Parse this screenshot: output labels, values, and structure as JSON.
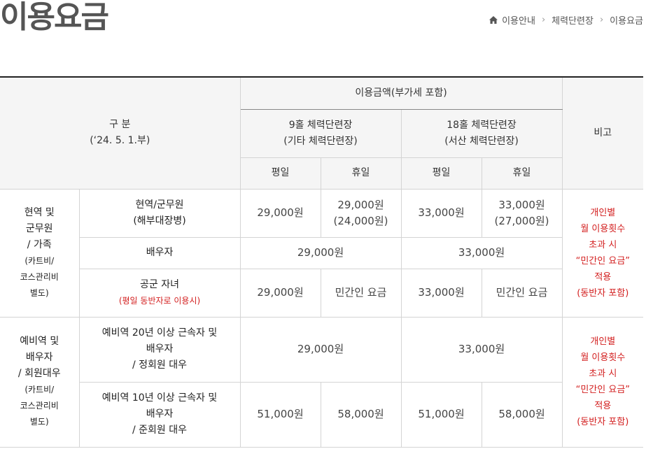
{
  "page": {
    "title": "이용요금"
  },
  "breadcrumb": {
    "items": [
      "이용안내",
      "체력단련장",
      "이용요금"
    ]
  },
  "table": {
    "header": {
      "category": "구 분",
      "category_date": "(‘24. 5. 1.부)",
      "fee_group": "이용금액(부가세 포함)",
      "course9": "9홀 체력단련장",
      "course9_sub": "(기타 체력단련장)",
      "course18": "18홀 체력단련장",
      "course18_sub": "(서산 체력단련장)",
      "weekday": "평일",
      "holiday": "휴일",
      "note": "비고"
    },
    "group1": {
      "category_lines": [
        "현역 및",
        "군무원",
        "/ 가족"
      ],
      "category_small": [
        "(카트비/",
        "코스관리비",
        "별도)"
      ],
      "rows": [
        {
          "sub": "현역/군무원",
          "sub2": "(해부대장병)",
          "w9": "29,000원",
          "h9": "29,000원",
          "h9_2": "(24,000원)",
          "w18": "33,000원",
          "h18": "33,000원",
          "h18_2": "(27,000원)"
        },
        {
          "sub": "배우자",
          "m9": "29,000원",
          "m18": "33,000원"
        },
        {
          "sub": "공군 자녀",
          "sub_red": "(평일 동반자로 이용시)",
          "w9": "29,000원",
          "h9": "민간인 요금",
          "w18": "33,000원",
          "h18": "민간인 요금"
        }
      ],
      "note_lines": [
        "개인별",
        "월 이용횟수",
        "초과 시",
        "“민간인 요금”",
        "적용",
        "(동반자 포함)"
      ]
    },
    "group2": {
      "category_lines": [
        "예비역 및",
        "배우자",
        "/ 회원대우"
      ],
      "category_small": [
        "(카트비/",
        "코스관리비",
        "별도)"
      ],
      "rows": [
        {
          "sub_lines": [
            "예비역 20년 이상 근속자 및",
            "배우자",
            "/ 정회원 대우"
          ],
          "m9": "29,000원",
          "m18": "33,000원"
        },
        {
          "sub_lines": [
            "예비역 10년 이상 근속자 및",
            "배우자",
            "/ 준회원 대우"
          ],
          "w9": "51,000원",
          "h9": "58,000원",
          "w18": "51,000원",
          "h18": "58,000원"
        }
      ],
      "note_lines": [
        "개인별",
        "월 이용횟수",
        "초과 시",
        "“민간인 요금”",
        "적용",
        "(동반자 포함)"
      ]
    }
  }
}
